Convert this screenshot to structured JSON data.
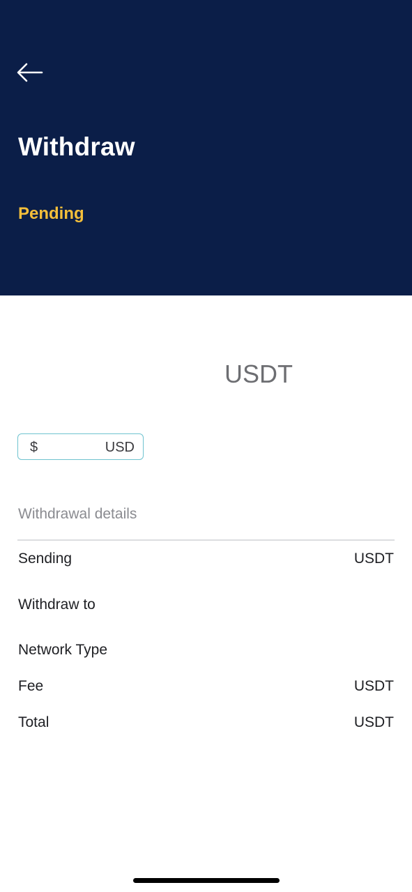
{
  "header": {
    "title": "Withdraw",
    "status": "Pending",
    "background_color": "#0b1e48",
    "status_color": "#f4bf3a"
  },
  "amount": {
    "currency": "USDT"
  },
  "fiat": {
    "symbol": "$",
    "currency": "USD",
    "border_color": "#6fc3cf"
  },
  "details": {
    "title": "Withdrawal details",
    "rows": [
      {
        "label": "Sending",
        "value": "USDT"
      },
      {
        "label": "Withdraw to",
        "value": ""
      },
      {
        "label": "Network Type",
        "value": ""
      },
      {
        "label": "Fee",
        "value": "USDT"
      },
      {
        "label": "Total",
        "value": "USDT"
      }
    ]
  },
  "icons": {
    "back": "arrow-left-icon"
  }
}
